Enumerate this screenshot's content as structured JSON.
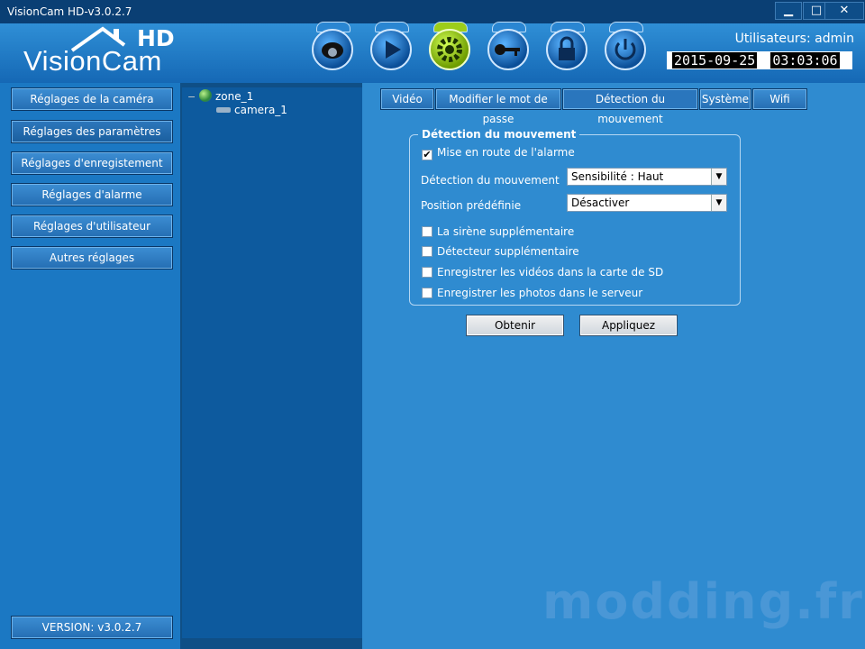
{
  "window": {
    "title": "VisionCam HD-v3.0.2.7",
    "minimize": "▁",
    "maximize": "□",
    "close": "✕"
  },
  "brand": {
    "name": "VisionCam",
    "tag": "HD"
  },
  "header": {
    "user_label": "Utilisateurs: admin",
    "date": "2015-09-25",
    "time": "03:03:06",
    "toolbar_icons": [
      "camera-icon",
      "play-icon",
      "gear-icon",
      "key-icon",
      "lock-icon",
      "power-icon"
    ],
    "active_icon": "gear-icon"
  },
  "sidebar": {
    "items": [
      {
        "label": "Réglages de la caméra"
      },
      {
        "label": "Réglages des paramètres"
      },
      {
        "label": "Réglages d'enregistement"
      },
      {
        "label": "Réglages d'alarme"
      },
      {
        "label": "Réglages d'utilisateur"
      },
      {
        "label": "Autres réglages"
      }
    ],
    "version": "VERSION: v3.0.2.7"
  },
  "tree": {
    "zone": "zone_1",
    "camera": "camera_1"
  },
  "tabs": [
    {
      "label": "Vidéo"
    },
    {
      "label": "Modifier le mot de passe"
    },
    {
      "label": "Détection du mouvement"
    },
    {
      "label": "Système"
    },
    {
      "label": "Wifi"
    }
  ],
  "motion": {
    "title": "Détection du mouvement",
    "enable_alarm": {
      "label": "Mise en route de l'alarme",
      "checked": true
    },
    "detection_label": "Détection du mouvement",
    "detection_value": "Sensibilité : Haut",
    "preset_label": "Position prédéfinie",
    "preset_value": "Désactiver",
    "options": [
      {
        "label": "La sirène supplémentaire",
        "checked": false
      },
      {
        "label": "Détecteur supplémentaire",
        "checked": false
      },
      {
        "label": "Enregistrer les vidéos dans la carte de SD",
        "checked": false
      },
      {
        "label": "Enregistrer les photos dans le serveur",
        "checked": false
      }
    ],
    "get_button": "Obtenir",
    "apply_button": "Appliquez"
  },
  "watermark": "modding.fr",
  "colors": {
    "accent_active": "#9ccd1a",
    "header": "#1b78c3",
    "panel": "#2f8bd0"
  }
}
